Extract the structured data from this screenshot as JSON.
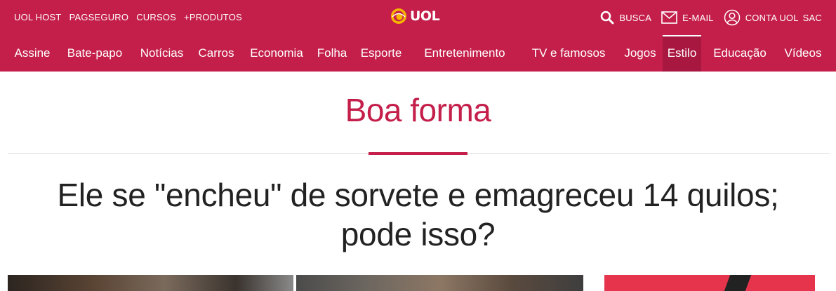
{
  "utility": {
    "left_links": [
      "UOL HOST",
      "PAGSEGURO",
      "CURSOS",
      "+PRODUTOS"
    ],
    "logo_text": "UOL",
    "search_label": "BUSCA",
    "email_label": "E-MAIL",
    "account_label": "CONTA UOL",
    "sac_label": "SAC"
  },
  "nav": {
    "items": [
      "Assine",
      "Bate-papo",
      "Notícias",
      "Carros",
      "Economia",
      "Folha",
      "Esporte",
      "Entretenimento",
      "TV e famosos",
      "Jogos",
      "Estilo",
      "Educação",
      "Vídeos"
    ],
    "active": "Estilo"
  },
  "section": {
    "title": "Boa forma"
  },
  "article": {
    "headline_line1": "Ele se \"encheu\" de sorvete e emagreceu 14 quilos;",
    "headline_line2": "pode isso?"
  },
  "colors": {
    "brand": "#c41f4a",
    "brand_dark": "#a81740",
    "text": "#222222"
  }
}
